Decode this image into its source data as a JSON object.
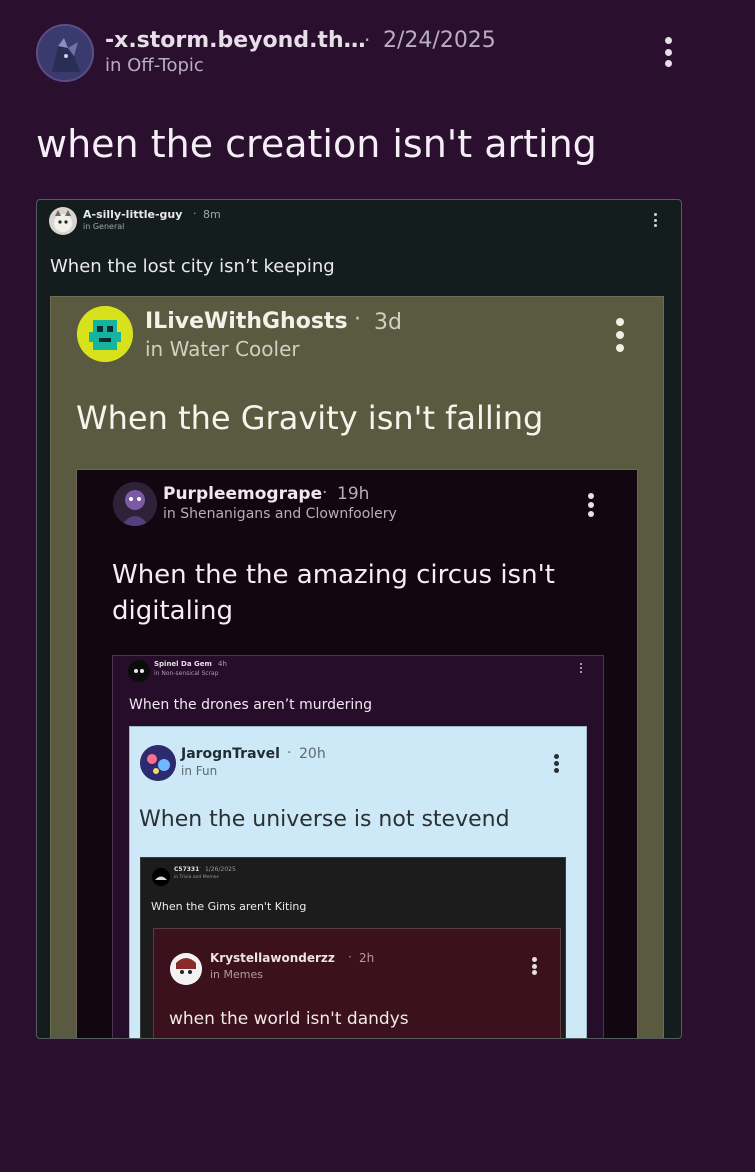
{
  "post": {
    "author": "-x.storm.beyond.th…",
    "date": "2/24/2025",
    "channel": "in Off-Topic",
    "title": "when the creation isn't arting"
  },
  "shot1": {
    "author": "A-silly-little-guy",
    "time": "8m",
    "channel": "in General",
    "title": "When the lost city isn’t keeping"
  },
  "shot2": {
    "author": "ILiveWithGhosts",
    "time": "3d",
    "channel": "in Water Cooler",
    "title": "When the Gravity isn't falling"
  },
  "shot3": {
    "author": "Purpleemogrape",
    "time": "19h",
    "channel": "in Shenanigans and Clownfoolery",
    "title_line1": "When the the amazing circus isn't",
    "title_line2": "digitaling"
  },
  "shot4": {
    "author": "Spinel Da Gem",
    "time": "4h",
    "channel": "in Non-sensical Scrap",
    "title": "When the drones aren’t murdering"
  },
  "shot5": {
    "author": "JarognTravel",
    "time": "20h",
    "channel": "in Fun",
    "title": "When the universe is not stevend"
  },
  "shot6": {
    "author": "C57331",
    "time": "1/26/2025",
    "channel": "in Trivia and Memes",
    "title": "When the Gims aren't Kiting"
  },
  "shot7": {
    "author": "Krystellawonderzz",
    "time": "2h",
    "channel": "in Memes",
    "title": "when the world isn't dandys"
  },
  "colors": {
    "bg": "#2a0f2e",
    "card1": "#141d1d",
    "card2": "#5a5a40",
    "card3": "#120711",
    "card4": "#260d2a",
    "card5": "#cde9f7",
    "card6": "#1c1c1d",
    "card7": "#3a111c"
  }
}
